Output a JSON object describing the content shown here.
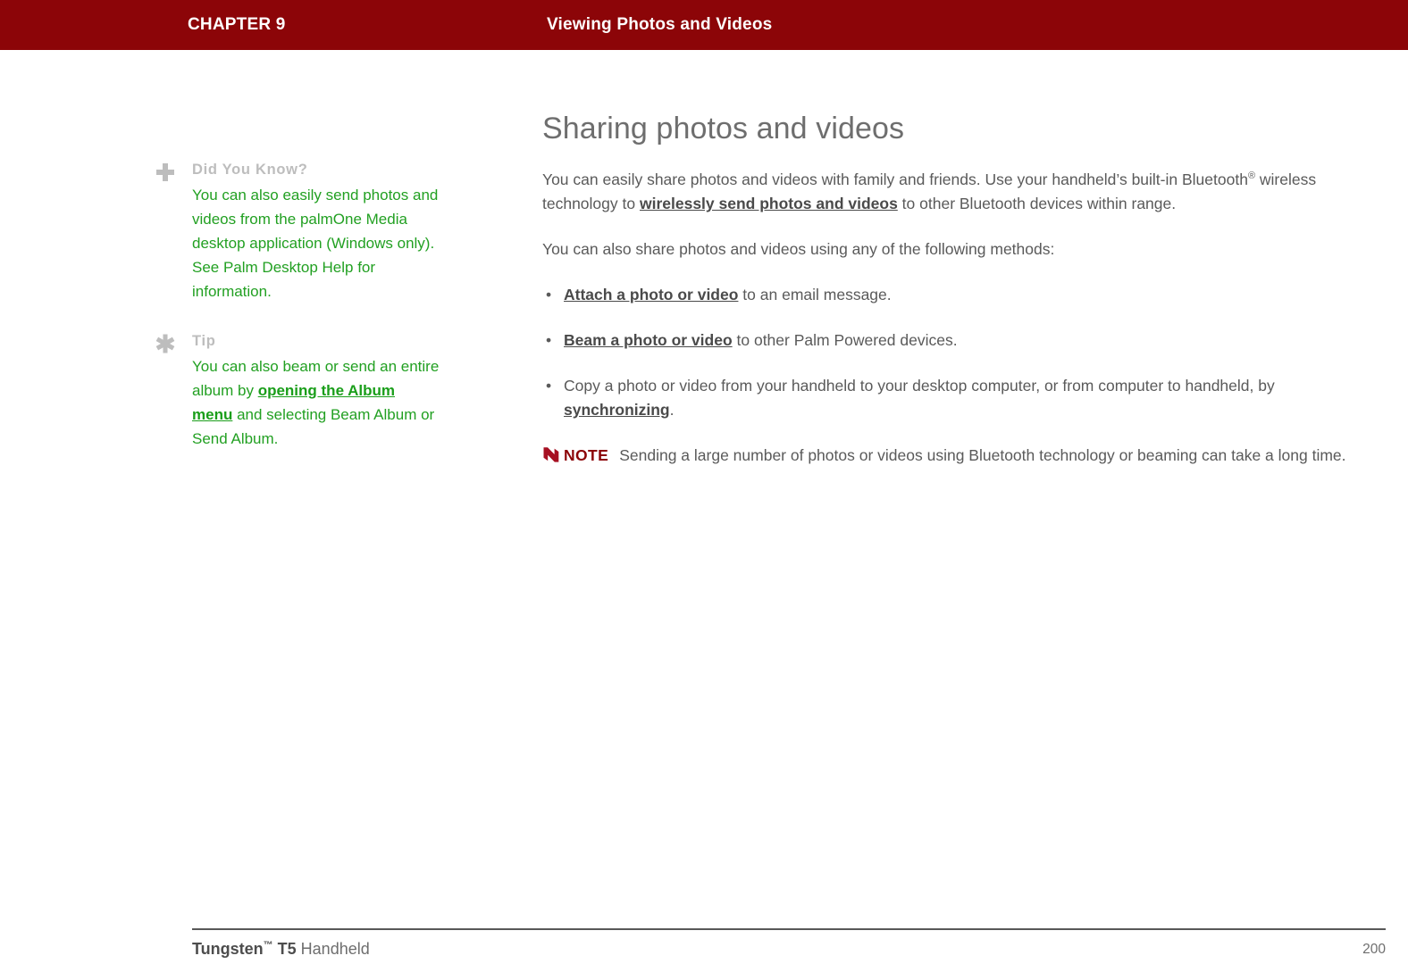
{
  "header": {
    "chapter": "CHAPTER 9",
    "title": "Viewing Photos and Videos",
    "background_color": "#8c0508",
    "text_color": "#ffffff"
  },
  "sidebar": {
    "accent_color": "#22a022",
    "heading_color": "#bdbdbd",
    "notes": [
      {
        "icon": "plus-icon",
        "heading": "Did You Know?",
        "text_before": "You can also easily send photos and videos from the palmOne Media desktop application (Windows only). See Palm Desktop Help for information.",
        "link": "",
        "text_after": ""
      },
      {
        "icon": "asterisk-icon",
        "heading": "Tip",
        "text_before": "You can also beam or send an entire album by ",
        "link": "opening the Album menu",
        "text_after": " and selecting Beam Album or Send Album."
      }
    ]
  },
  "main": {
    "heading": "Sharing photos and videos",
    "intro": {
      "part1": "You can easily share photos and videos with family and friends. Use your handheld’s built-in Bluetooth",
      "superscript": "®",
      "part2": " wireless technology to ",
      "link": "wirelessly send photos and videos",
      "part3": " to other Bluetooth devices within range."
    },
    "methods_intro": "You can also share photos and videos using any of the following methods:",
    "bullets": [
      {
        "link": "Attach a photo or video",
        "text_after": " to an email message.",
        "text_before": ""
      },
      {
        "link": "Beam a photo or video",
        "text_after": " to other Palm Powered devices.",
        "text_before": ""
      },
      {
        "text_before": "Copy a photo or video from your handheld to your desktop computer, or from computer to handheld, by ",
        "link": "synchronizing",
        "text_after": "."
      }
    ],
    "note": {
      "icon": "note-flag-icon",
      "label": "NOTE",
      "label_color": "#8c0508",
      "text": "Sending a large number of photos or videos using Bluetooth technology or beaming can take a long time."
    }
  },
  "footer": {
    "product_bold": "Tungsten",
    "product_tm": "™",
    "product_model": " T5",
    "product_rest": " Handheld",
    "page_number": "200"
  }
}
